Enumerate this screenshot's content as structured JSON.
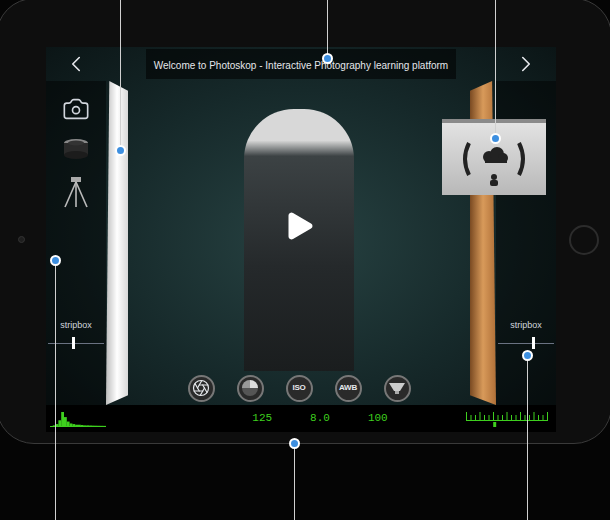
{
  "screen": {
    "title": "Welcome to Photoskop - Interactive Photography learning platform"
  },
  "lights": {
    "left": {
      "label": "stripbox",
      "level": 0.45
    },
    "right": {
      "label": "stripbox",
      "level": 0.63
    }
  },
  "setting_buttons": [
    {
      "kind": "aperture",
      "label": ""
    },
    {
      "kind": "shutter",
      "label": ""
    },
    {
      "kind": "text",
      "label": "ISO"
    },
    {
      "kind": "text",
      "label": "AWB"
    },
    {
      "kind": "flash",
      "label": ""
    }
  ],
  "readings": [
    "125",
    "8.0",
    "100"
  ],
  "histogram": {
    "values": [
      0,
      1,
      3,
      9,
      22,
      14,
      7,
      4,
      3,
      2,
      2,
      1.5,
      1,
      1,
      0.8,
      0.6,
      0.5,
      0.4,
      0.3,
      0.2
    ]
  },
  "exposure_meter": {
    "level": 0.35
  }
}
